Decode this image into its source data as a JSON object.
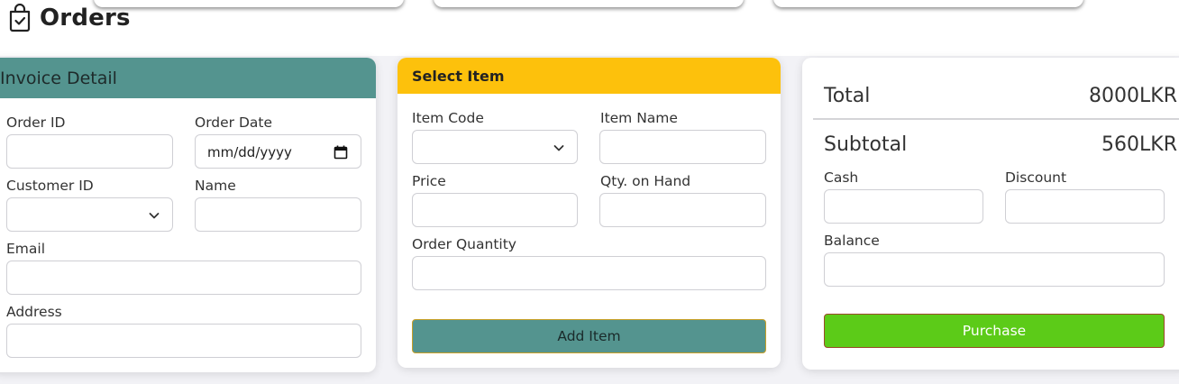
{
  "page": {
    "title": "Orders"
  },
  "colors": {
    "invoice_header": "#54948f",
    "item_header": "#fdc10c",
    "add_button": "#54948f",
    "purchase_button": "#5ccb18"
  },
  "invoice": {
    "title": "Invoice Detail",
    "order_id_label": "Order ID",
    "order_date_label": "Order Date",
    "order_date_placeholder": "mm/dd/yyyy",
    "customer_id_label": "Customer ID",
    "name_label": "Name",
    "email_label": "Email",
    "address_label": "Address"
  },
  "item": {
    "title": "Select Item",
    "code_label": "Item Code",
    "name_label": "Item Name",
    "price_label": "Price",
    "qty_on_hand_label": "Qty. on Hand",
    "order_qty_label": "Order Quantity",
    "add_button": "Add Item"
  },
  "summary": {
    "total_label": "Total",
    "total_value": "8000LKR",
    "subtotal_label": "Subtotal",
    "subtotal_value": "560LKR",
    "cash_label": "Cash",
    "discount_label": "Discount",
    "balance_label": "Balance",
    "purchase_button": "Purchase"
  }
}
